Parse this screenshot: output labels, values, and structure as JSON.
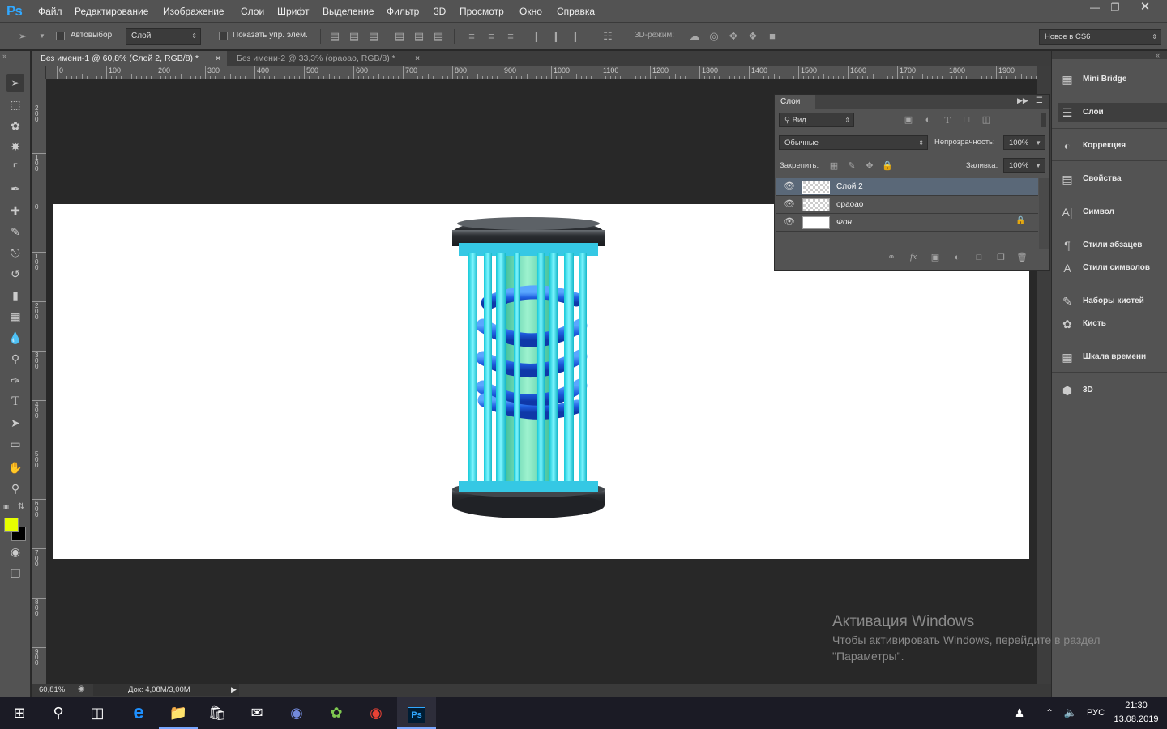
{
  "app": {
    "logo": "Ps"
  },
  "menu": [
    "Файл",
    "Редактирование",
    "Изображение",
    "Слои",
    "Шрифт",
    "Выделение",
    "Фильтр",
    "3D",
    "Просмотр",
    "Окно",
    "Справка"
  ],
  "options": {
    "autoselect_label": "Автовыбор:",
    "autoselect_value": "Слой",
    "show_transform_label": "Показать упр. элем.",
    "mode3d_label": "3D-режим:",
    "workspace": "Новое в CS6"
  },
  "tabs": [
    {
      "title": "Без имени-1 @ 60,8% (Слой 2, RGB/8) *",
      "close": "×"
    },
    {
      "title": "Без имени-2 @ 33,3% (ораоао, RGB/8) *",
      "close": "×"
    }
  ],
  "ruler_top": [
    "0",
    "100",
    "200",
    "300",
    "400",
    "500",
    "600",
    "700",
    "800",
    "900",
    "1000",
    "1100",
    "1200",
    "1300",
    "1400",
    "1500",
    "1600",
    "1700",
    "1800",
    "1900"
  ],
  "ruler_left": [
    "2 0 0",
    "1 0 0",
    "0",
    "1 0 0",
    "2 0 0",
    "3 0 0",
    "4 0 0",
    "5 0 0",
    "6 0 0",
    "7 0 0",
    "8 0 0",
    "9 0 0"
  ],
  "status": {
    "zoom": "60,81%",
    "doc": "Док: 4,08M/3,00M"
  },
  "layers_panel": {
    "title": "Слои",
    "filter": "Вид",
    "blend": "Обычные",
    "opacity_label": "Непрозрачность:",
    "opacity": "100%",
    "lock_label": "Закрепить:",
    "fill_label": "Заливка:",
    "fill": "100%",
    "layers": [
      "Слой 2",
      "ораоао",
      "Фон"
    ]
  },
  "dock": [
    "Mini Bridge",
    "Слои",
    "Коррекция",
    "Свойства",
    "Символ",
    "Стили абзацев",
    "Стили символов",
    "Наборы кистей",
    "Кисть",
    "Шкала времени",
    "3D"
  ],
  "watermark": {
    "title": "Активация Windows",
    "line1": "Чтобы активировать Windows, перейдите в раздел",
    "line2": "\"Параметры\"."
  },
  "taskbar": {
    "lang": "РУС",
    "time": "21:30",
    "date": "13.08.2019"
  },
  "colors": {
    "foreground": "#e6ff00",
    "background": "#000000",
    "accent": "#31a8ff"
  }
}
